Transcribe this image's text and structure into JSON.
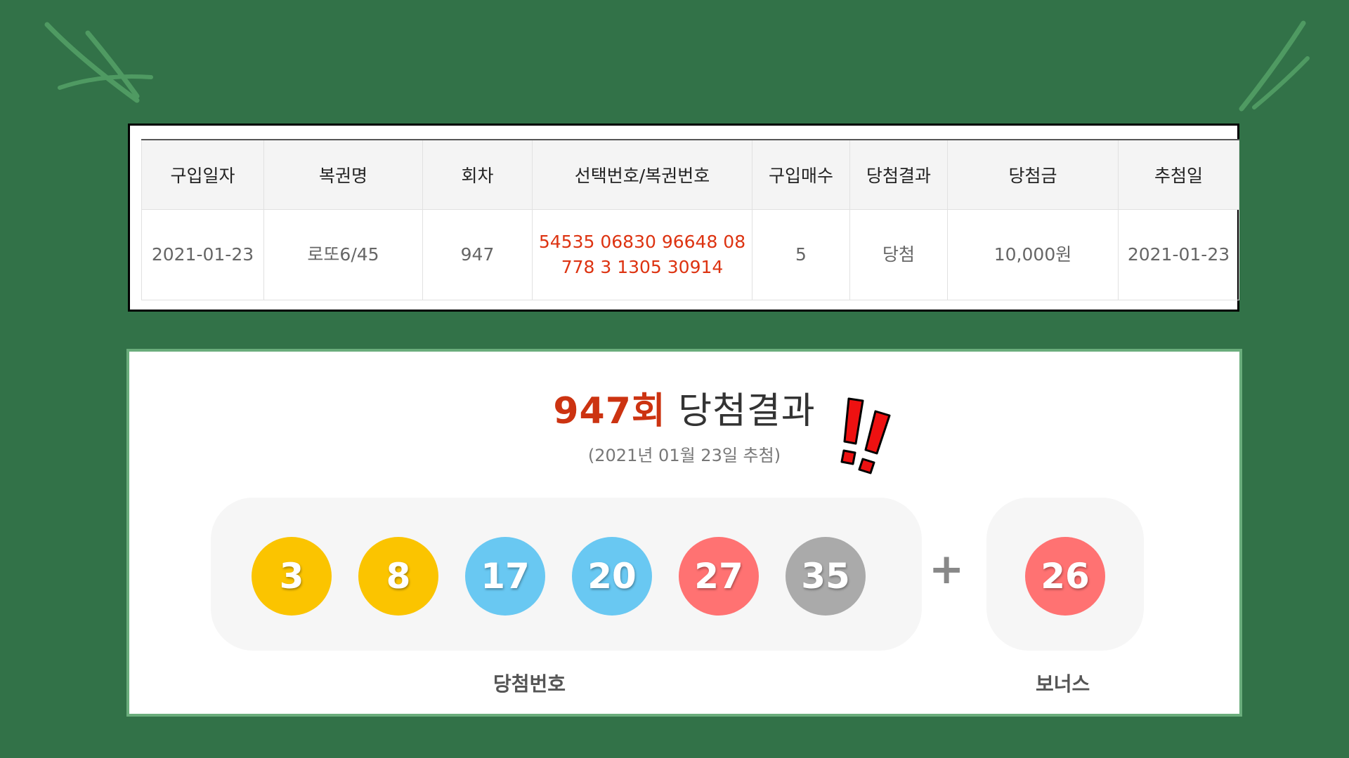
{
  "theme": {
    "background": "#327248",
    "accent_red": "#cc3311",
    "ball_yellow": "#fbc400",
    "ball_blue": "#69c8f2",
    "ball_red": "#ff7272",
    "ball_gray": "#aaaaaa"
  },
  "purchase_table": {
    "headers": [
      "구입일자",
      "복권명",
      "회차",
      "선택번호/복권번호",
      "구입매수",
      "당첨결과",
      "당첨금",
      "추첨일"
    ],
    "row": {
      "purchase_date": "2021-01-23",
      "lottery_name": "로또6/45",
      "round": "947",
      "numbers": "54535 06830 96648 08778 3 1305 30914",
      "quantity": "5",
      "result": "당첨",
      "prize": "10,000원",
      "draw_date": "2021-01-23"
    }
  },
  "result": {
    "round_label": "947회",
    "title_suffix": "당첨결과",
    "draw_date_text": "(2021년 01월 23일 추첨)",
    "winning_numbers": [
      {
        "number": "3",
        "color": "yellow"
      },
      {
        "number": "8",
        "color": "yellow"
      },
      {
        "number": "17",
        "color": "blue"
      },
      {
        "number": "20",
        "color": "blue"
      },
      {
        "number": "27",
        "color": "red"
      },
      {
        "number": "35",
        "color": "gray"
      }
    ],
    "plus_symbol": "+",
    "bonus_number": {
      "number": "26",
      "color": "red"
    },
    "winning_caption": "당첨번호",
    "bonus_caption": "보너스"
  },
  "decorations": [
    "leaf-icon-left",
    "leaf-icon-right",
    "exclamation-icon"
  ]
}
